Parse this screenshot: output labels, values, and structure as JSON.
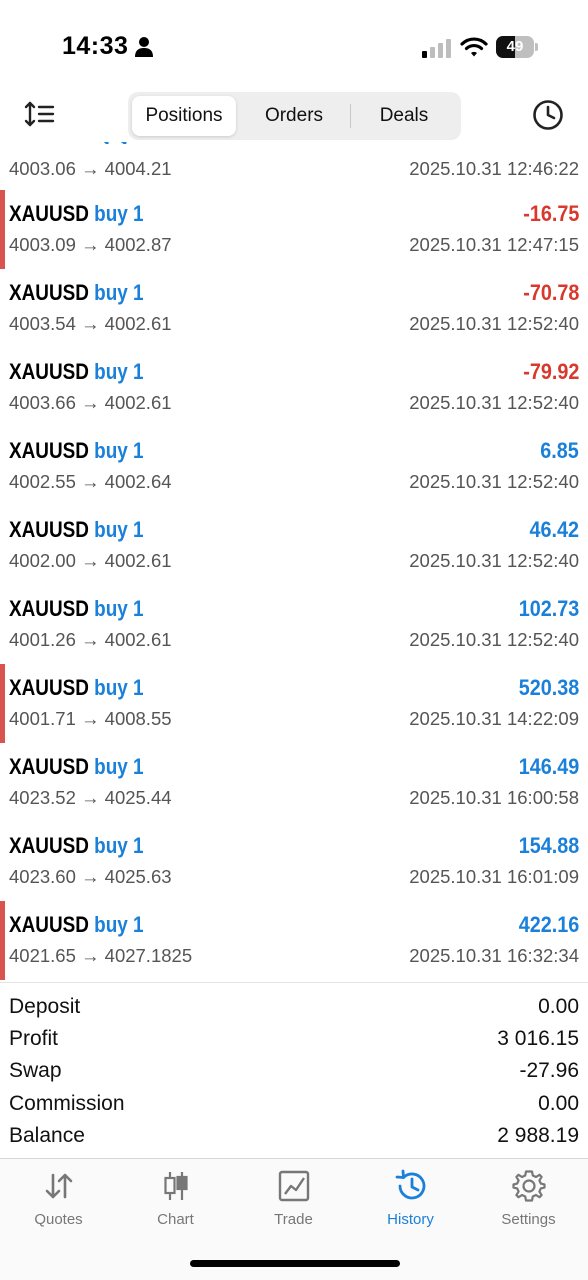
{
  "status_bar": {
    "time": "14:33",
    "battery": "49",
    "battery_level": 0.49
  },
  "segments": [
    {
      "label": "Positions",
      "active": true
    },
    {
      "label": "Orders",
      "active": false
    },
    {
      "label": "Deals",
      "active": false
    }
  ],
  "partial_row": {
    "prices": "4003.06 → 4004.21",
    "time": "2025.10.31 12:46:22"
  },
  "deals": [
    {
      "symbol": "XAUUSD",
      "direction": "buy 1",
      "prices": "4003.09 → 4002.87",
      "profit": "-16.75",
      "time": "2025.10.31 12:47:15",
      "marker": true
    },
    {
      "symbol": "XAUUSD",
      "direction": "buy 1",
      "prices": "4003.54 → 4002.61",
      "profit": "-70.78",
      "time": "2025.10.31 12:52:40",
      "marker": false
    },
    {
      "symbol": "XAUUSD",
      "direction": "buy 1",
      "prices": "4003.66 → 4002.61",
      "profit": "-79.92",
      "time": "2025.10.31 12:52:40",
      "marker": false
    },
    {
      "symbol": "XAUUSD",
      "direction": "buy 1",
      "prices": "4002.55 → 4002.64",
      "profit": "6.85",
      "time": "2025.10.31 12:52:40",
      "marker": false
    },
    {
      "symbol": "XAUUSD",
      "direction": "buy 1",
      "prices": "4002.00 → 4002.61",
      "profit": "46.42",
      "time": "2025.10.31 12:52:40",
      "marker": false
    },
    {
      "symbol": "XAUUSD",
      "direction": "buy 1",
      "prices": "4001.26 → 4002.61",
      "profit": "102.73",
      "time": "2025.10.31 12:52:40",
      "marker": false
    },
    {
      "symbol": "XAUUSD",
      "direction": "buy 1",
      "prices": "4001.71 → 4008.55",
      "profit": "520.38",
      "time": "2025.10.31 14:22:09",
      "marker": true
    },
    {
      "symbol": "XAUUSD",
      "direction": "buy 1",
      "prices": "4023.52 → 4025.44",
      "profit": "146.49",
      "time": "2025.10.31 16:00:58",
      "marker": false
    },
    {
      "symbol": "XAUUSD",
      "direction": "buy 1",
      "prices": "4023.60 → 4025.63",
      "profit": "154.88",
      "time": "2025.10.31 16:01:09",
      "marker": false
    },
    {
      "symbol": "XAUUSD",
      "direction": "buy 1",
      "prices": "4021.65 → 4027.1825",
      "profit": "422.16",
      "time": "2025.10.31 16:32:34",
      "marker": true
    }
  ],
  "summary": [
    {
      "label": "Deposit",
      "value": "0.00"
    },
    {
      "label": "Profit",
      "value": "3 016.15"
    },
    {
      "label": "Swap",
      "value": "-27.96"
    },
    {
      "label": "Commission",
      "value": "0.00"
    },
    {
      "label": "Balance",
      "value": "2 988.19"
    }
  ],
  "tabs": [
    {
      "label": "Quotes",
      "icon": "quotes-arrows-icon",
      "active": false
    },
    {
      "label": "Chart",
      "icon": "candlestick-chart-icon",
      "active": false
    },
    {
      "label": "Trade",
      "icon": "trade-chart-icon",
      "active": false
    },
    {
      "label": "History",
      "icon": "history-clock-icon",
      "active": true
    },
    {
      "label": "Settings",
      "icon": "gear-icon",
      "active": false
    }
  ],
  "colors": {
    "accent": "#1a80d9",
    "negative": "#d9382c",
    "marker": "#d9534f",
    "muted_text": "#555555"
  }
}
